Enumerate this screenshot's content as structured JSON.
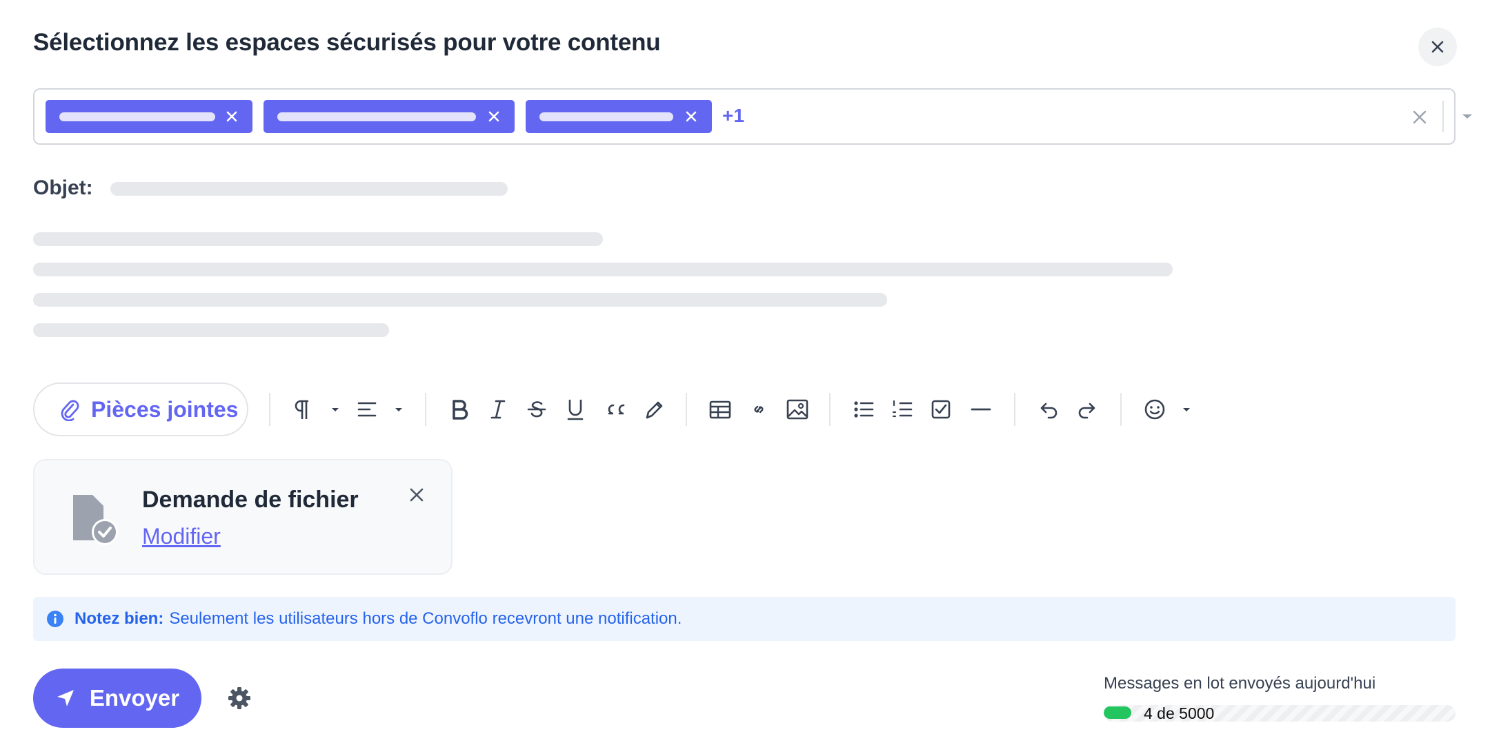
{
  "dialog": {
    "title": "Sélectionnez les espaces sécurisés pour votre contenu"
  },
  "recipients": {
    "more_label": "+1"
  },
  "subject": {
    "label": "Objet:"
  },
  "toolbar": {
    "attachments_label": "Pièces jointes"
  },
  "file_request": {
    "title": "Demande de fichier",
    "edit_link": "Modifier"
  },
  "note": {
    "bold": "Notez bien:",
    "text": "Seulement les utilisateurs hors de Convoflo recevront une notification."
  },
  "actions": {
    "send_label": "Envoyer"
  },
  "quota": {
    "label": "Messages en lot envoyés aujourd'hui",
    "text": "4 de 5000",
    "used": 4,
    "total": 5000
  },
  "colors": {
    "accent": "#6366f1",
    "progress": "#22c55e",
    "info": "#2563eb"
  }
}
